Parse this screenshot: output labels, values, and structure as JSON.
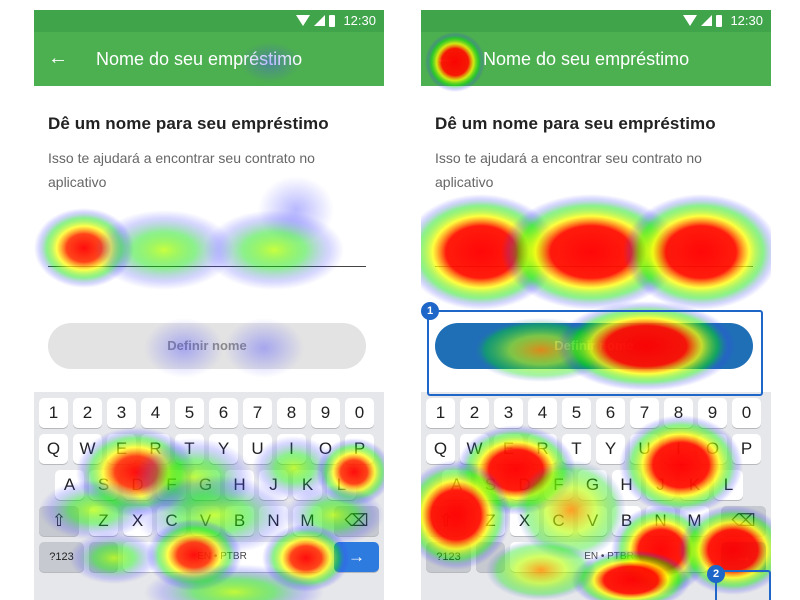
{
  "status_bar": {
    "time": "12:30"
  },
  "app_bar": {
    "title": "Nome do seu empréstimo"
  },
  "content": {
    "heading": "Dê um nome para seu empréstimo",
    "subtitle": "Isso te ajudará a encontrar seu contrato no aplicativo",
    "input_value": "",
    "button_label": "Definir nome"
  },
  "keyboard": {
    "row_numbers": [
      "1",
      "2",
      "3",
      "4",
      "5",
      "6",
      "7",
      "8",
      "9",
      "0"
    ],
    "row_top": [
      "Q",
      "W",
      "E",
      "R",
      "T",
      "Y",
      "U",
      "I",
      "O",
      "P"
    ],
    "row_mid": [
      "A",
      "S",
      "D",
      "F",
      "G",
      "H",
      "J",
      "K",
      "L"
    ],
    "row_bottom": [
      "Z",
      "X",
      "C",
      "V",
      "B",
      "N",
      "M"
    ],
    "shift_label": "⇧",
    "backspace_label": "⌫",
    "symbols_label": "?123",
    "space_label": "EN • PTBR",
    "enter_label": "→"
  },
  "callouts": {
    "first": "1",
    "second": "2"
  },
  "colors": {
    "status_bar": "#40a44b",
    "app_bar": "#4caf50",
    "button_disabled": "#e3e3e3",
    "button_blue": "#1f6fb6",
    "callout": "#1e66c8",
    "heat_hot": "#ff0000",
    "heat_warm": "#ffff00",
    "heat_mid": "#00e000",
    "heat_cool": "#3a3aff"
  },
  "icons": [
    "back-arrow-icon",
    "wifi-icon",
    "signal-icon",
    "battery-icon",
    "shift-icon",
    "backspace-icon",
    "enter-icon"
  ]
}
